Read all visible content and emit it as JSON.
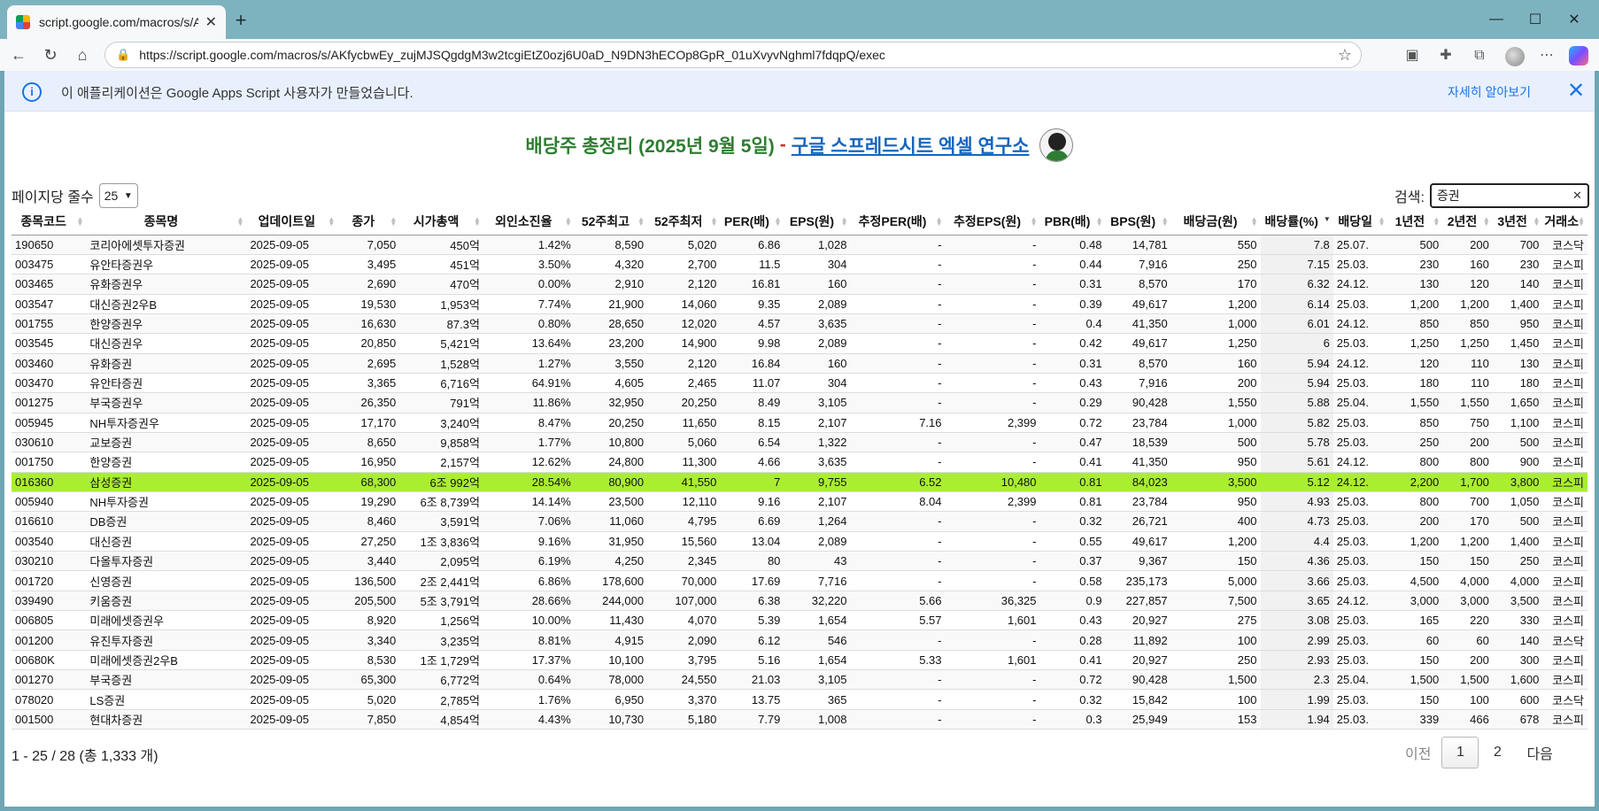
{
  "browser": {
    "tab_title": "script.google.com/macros/s/AKfy",
    "url": "https://script.google.com/macros/s/AKfycbwEy_zujMJSQgdgM3w2tcgiEtZ0ozj6U0aD_N9DN3hECOp8GpR_01uXvyvNghml7fdqpQ/exec",
    "icons": [
      "back-icon",
      "reload-icon",
      "home-icon",
      "star-icon",
      "extensions-icon",
      "collections-icon",
      "menu-icon"
    ]
  },
  "banner": {
    "message": "이 애플리케이션은 Google Apps Script 사용자가 만들었습니다.",
    "learn_more": "자세히 알아보기"
  },
  "headline": {
    "title": "배당주 총정리 (2025년 9월 5일)",
    "separator": "-",
    "link": "구글 스프레드시트 엑셀 연구소"
  },
  "controls": {
    "per_page_label": "페이지당 줄수",
    "per_page_value": "25",
    "search_label": "검색:",
    "search_value": "증권"
  },
  "table": {
    "columns": [
      "종목코드",
      "종목명",
      "업데이트일",
      "종가",
      "시가총액",
      "외인소진율",
      "52주최고",
      "52주최저",
      "PER(배)",
      "EPS(원)",
      "추정PER(배)",
      "추정EPS(원)",
      "PBR(배)",
      "BPS(원)",
      "배당금(원)",
      "배당률(%)",
      "배당일",
      "1년전",
      "2년전",
      "3년전",
      "거래소"
    ],
    "rows": [
      [
        "190650",
        "코리아에셋투자증권",
        "2025-09-05",
        "7,050",
        "450억",
        "1.42%",
        "8,590",
        "5,020",
        "6.86",
        "1,028",
        "-",
        "-",
        "0.48",
        "14,781",
        "550",
        "7.8",
        "25.07.",
        "500",
        "200",
        "700",
        "코스닥"
      ],
      [
        "003475",
        "유안타증권우",
        "2025-09-05",
        "3,495",
        "451억",
        "3.50%",
        "4,320",
        "2,700",
        "11.5",
        "304",
        "-",
        "-",
        "0.44",
        "7,916",
        "250",
        "7.15",
        "25.03.",
        "230",
        "160",
        "230",
        "코스피"
      ],
      [
        "003465",
        "유화증권우",
        "2025-09-05",
        "2,690",
        "470억",
        "0.00%",
        "2,910",
        "2,120",
        "16.81",
        "160",
        "-",
        "-",
        "0.31",
        "8,570",
        "170",
        "6.32",
        "24.12.",
        "130",
        "120",
        "140",
        "코스피"
      ],
      [
        "003547",
        "대신증권2우B",
        "2025-09-05",
        "19,530",
        "1,953억",
        "7.74%",
        "21,900",
        "14,060",
        "9.35",
        "2,089",
        "-",
        "-",
        "0.39",
        "49,617",
        "1,200",
        "6.14",
        "25.03.",
        "1,200",
        "1,200",
        "1,400",
        "코스피"
      ],
      [
        "001755",
        "한양증권우",
        "2025-09-05",
        "16,630",
        "87.3억",
        "0.80%",
        "28,650",
        "12,020",
        "4.57",
        "3,635",
        "-",
        "-",
        "0.4",
        "41,350",
        "1,000",
        "6.01",
        "24.12.",
        "850",
        "850",
        "950",
        "코스피"
      ],
      [
        "003545",
        "대신증권우",
        "2025-09-05",
        "20,850",
        "5,421억",
        "13.64%",
        "23,200",
        "14,900",
        "9.98",
        "2,089",
        "-",
        "-",
        "0.42",
        "49,617",
        "1,250",
        "6",
        "25.03.",
        "1,250",
        "1,250",
        "1,450",
        "코스피"
      ],
      [
        "003460",
        "유화증권",
        "2025-09-05",
        "2,695",
        "1,528억",
        "1.27%",
        "3,550",
        "2,120",
        "16.84",
        "160",
        "-",
        "-",
        "0.31",
        "8,570",
        "160",
        "5.94",
        "24.12.",
        "120",
        "110",
        "130",
        "코스피"
      ],
      [
        "003470",
        "유안타증권",
        "2025-09-05",
        "3,365",
        "6,716억",
        "64.91%",
        "4,605",
        "2,465",
        "11.07",
        "304",
        "-",
        "-",
        "0.43",
        "7,916",
        "200",
        "5.94",
        "25.03.",
        "180",
        "110",
        "180",
        "코스피"
      ],
      [
        "001275",
        "부국증권우",
        "2025-09-05",
        "26,350",
        "791억",
        "11.86%",
        "32,950",
        "20,250",
        "8.49",
        "3,105",
        "-",
        "-",
        "0.29",
        "90,428",
        "1,550",
        "5.88",
        "25.04.",
        "1,550",
        "1,550",
        "1,650",
        "코스피"
      ],
      [
        "005945",
        "NH투자증권우",
        "2025-09-05",
        "17,170",
        "3,240억",
        "8.47%",
        "20,250",
        "11,650",
        "8.15",
        "2,107",
        "7.16",
        "2,399",
        "0.72",
        "23,784",
        "1,000",
        "5.82",
        "25.03.",
        "850",
        "750",
        "1,100",
        "코스피"
      ],
      [
        "030610",
        "교보증권",
        "2025-09-05",
        "8,650",
        "9,858억",
        "1.77%",
        "10,800",
        "5,060",
        "6.54",
        "1,322",
        "-",
        "-",
        "0.47",
        "18,539",
        "500",
        "5.78",
        "25.03.",
        "250",
        "200",
        "500",
        "코스피"
      ],
      [
        "001750",
        "한양증권",
        "2025-09-05",
        "16,950",
        "2,157억",
        "12.62%",
        "24,800",
        "11,300",
        "4.66",
        "3,635",
        "-",
        "-",
        "0.41",
        "41,350",
        "950",
        "5.61",
        "24.12.",
        "800",
        "800",
        "900",
        "코스피"
      ],
      [
        "016360",
        "삼성증권",
        "2025-09-05",
        "68,300",
        "6조 992억",
        "28.54%",
        "80,900",
        "41,550",
        "7",
        "9,755",
        "6.52",
        "10,480",
        "0.81",
        "84,023",
        "3,500",
        "5.12",
        "24.12.",
        "2,200",
        "1,700",
        "3,800",
        "코스피"
      ],
      [
        "005940",
        "NH투자증권",
        "2025-09-05",
        "19,290",
        "6조 8,739억",
        "14.14%",
        "23,500",
        "12,110",
        "9.16",
        "2,107",
        "8.04",
        "2,399",
        "0.81",
        "23,784",
        "950",
        "4.93",
        "25.03.",
        "800",
        "700",
        "1,050",
        "코스피"
      ],
      [
        "016610",
        "DB증권",
        "2025-09-05",
        "8,460",
        "3,591억",
        "7.06%",
        "11,060",
        "4,795",
        "6.69",
        "1,264",
        "-",
        "-",
        "0.32",
        "26,721",
        "400",
        "4.73",
        "25.03.",
        "200",
        "170",
        "500",
        "코스피"
      ],
      [
        "003540",
        "대신증권",
        "2025-09-05",
        "27,250",
        "1조 3,836억",
        "9.16%",
        "31,950",
        "15,560",
        "13.04",
        "2,089",
        "-",
        "-",
        "0.55",
        "49,617",
        "1,200",
        "4.4",
        "25.03.",
        "1,200",
        "1,200",
        "1,400",
        "코스피"
      ],
      [
        "030210",
        "다올투자증권",
        "2025-09-05",
        "3,440",
        "2,095억",
        "6.19%",
        "4,250",
        "2,345",
        "80",
        "43",
        "-",
        "-",
        "0.37",
        "9,367",
        "150",
        "4.36",
        "25.03.",
        "150",
        "150",
        "250",
        "코스피"
      ],
      [
        "001720",
        "신영증권",
        "2025-09-05",
        "136,500",
        "2조 2,441억",
        "6.86%",
        "178,600",
        "70,000",
        "17.69",
        "7,716",
        "-",
        "-",
        "0.58",
        "235,173",
        "5,000",
        "3.66",
        "25.03.",
        "4,500",
        "4,000",
        "4,000",
        "코스피"
      ],
      [
        "039490",
        "키움증권",
        "2025-09-05",
        "205,500",
        "5조 3,791억",
        "28.66%",
        "244,000",
        "107,000",
        "6.38",
        "32,220",
        "5.66",
        "36,325",
        "0.9",
        "227,857",
        "7,500",
        "3.65",
        "24.12.",
        "3,000",
        "3,000",
        "3,500",
        "코스피"
      ],
      [
        "006805",
        "미래에셋증권우",
        "2025-09-05",
        "8,920",
        "1,256억",
        "10.00%",
        "11,430",
        "4,070",
        "5.39",
        "1,654",
        "5.57",
        "1,601",
        "0.43",
        "20,927",
        "275",
        "3.08",
        "25.03.",
        "165",
        "220",
        "330",
        "코스피"
      ],
      [
        "001200",
        "유진투자증권",
        "2025-09-05",
        "3,340",
        "3,235억",
        "8.81%",
        "4,915",
        "2,090",
        "6.12",
        "546",
        "-",
        "-",
        "0.28",
        "11,892",
        "100",
        "2.99",
        "25.03.",
        "60",
        "60",
        "140",
        "코스닥"
      ],
      [
        "00680K",
        "미래에셋증권2우B",
        "2025-09-05",
        "8,530",
        "1조 1,729억",
        "17.37%",
        "10,100",
        "3,795",
        "5.16",
        "1,654",
        "5.33",
        "1,601",
        "0.41",
        "20,927",
        "250",
        "2.93",
        "25.03.",
        "150",
        "200",
        "300",
        "코스피"
      ],
      [
        "001270",
        "부국증권",
        "2025-09-05",
        "65,300",
        "6,772억",
        "0.64%",
        "78,000",
        "24,550",
        "21.03",
        "3,105",
        "-",
        "-",
        "0.72",
        "90,428",
        "1,500",
        "2.3",
        "25.04.",
        "1,500",
        "1,500",
        "1,600",
        "코스피"
      ],
      [
        "078020",
        "LS증권",
        "2025-09-05",
        "5,020",
        "2,785억",
        "1.76%",
        "6,950",
        "3,370",
        "13.75",
        "365",
        "-",
        "-",
        "0.32",
        "15,842",
        "100",
        "1.99",
        "25.03.",
        "150",
        "100",
        "600",
        "코스닥"
      ],
      [
        "001500",
        "현대차증권",
        "2025-09-05",
        "7,850",
        "4,854억",
        "4.43%",
        "10,730",
        "5,180",
        "7.79",
        "1,008",
        "-",
        "-",
        "0.3",
        "25,949",
        "153",
        "1.94",
        "25.03.",
        "339",
        "466",
        "678",
        "코스피"
      ]
    ],
    "highlight_row": 12,
    "sorted_column": 15,
    "highlight_color": "#aaee30"
  },
  "footer": {
    "info": "1 - 25 / 28 (총 1,333 개)",
    "prev": "이전",
    "pages": [
      "1",
      "2"
    ],
    "current_page": "1",
    "next": "다음"
  }
}
